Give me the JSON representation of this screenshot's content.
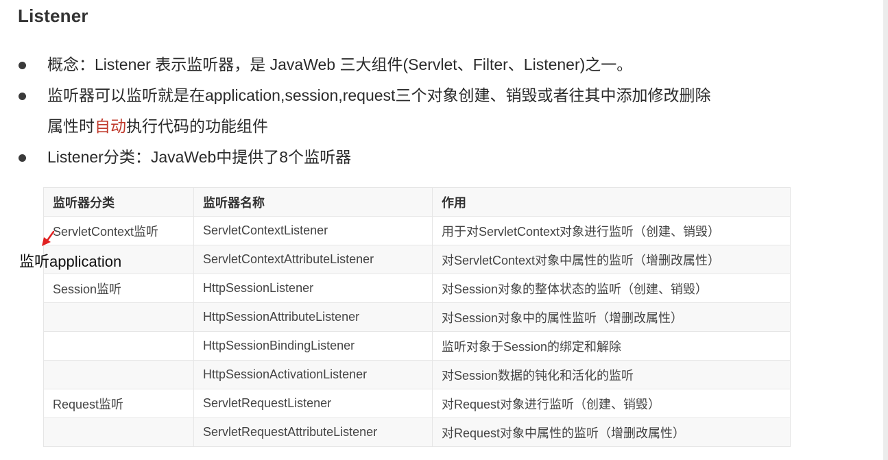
{
  "section": {
    "title": "Listener"
  },
  "bullets": [
    {
      "text": "概念：Listener 表示监听器，是 JavaWeb 三大组件(Servlet、Filter、Listener)之一。"
    },
    {
      "line1": "监听器可以监听就是在application,session,request三个对象创建、销毁或者往其中添加修改删除",
      "line2_before": "属性时",
      "line2_highlight": "自动",
      "line2_after": "执行代码的功能组件"
    },
    {
      "text": "Listener分类：JavaWeb中提供了8个监听器"
    }
  ],
  "table": {
    "headers": [
      "监听器分类",
      "监听器名称",
      "作用"
    ],
    "rows": [
      [
        "ServletContext监听",
        "ServletContextListener",
        "用于对ServletContext对象进行监听（创建、销毁）"
      ],
      [
        "",
        "ServletContextAttributeListener",
        "对ServletContext对象中属性的监听（增删改属性）"
      ],
      [
        "Session监听",
        "HttpSessionListener",
        "对Session对象的整体状态的监听（创建、销毁）"
      ],
      [
        "",
        "HttpSessionAttributeListener",
        "对Session对象中的属性监听（增删改属性）"
      ],
      [
        "",
        "HttpSessionBindingListener",
        "监听对象于Session的绑定和解除"
      ],
      [
        "",
        "HttpSessionActivationListener",
        "对Session数据的钝化和活化的监听"
      ],
      [
        "Request监听",
        "ServletRequestListener",
        "对Request对象进行监听（创建、销毁）"
      ],
      [
        "",
        "ServletRequestAttributeListener",
        "对Request对象中属性的监听（增删改属性）"
      ]
    ]
  },
  "annotation": {
    "text": "监听application",
    "arrow_color": "#e02020"
  },
  "colors": {
    "highlight": "#c0392b",
    "table_border": "#e6e6e6",
    "table_stripe": "#f8f8f8"
  }
}
